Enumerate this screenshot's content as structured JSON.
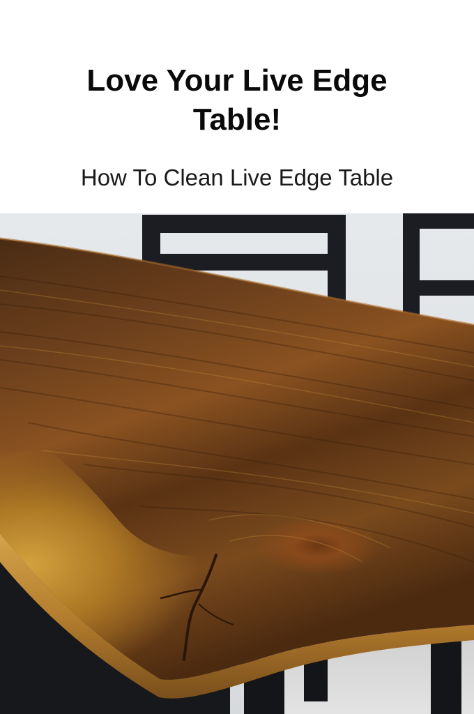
{
  "header": {
    "title": "Love Your Live Edge Table!",
    "subtitle": "How To Clean Live Edge Table"
  },
  "photo": {
    "subject": "live-edge wood table with black chairs"
  }
}
